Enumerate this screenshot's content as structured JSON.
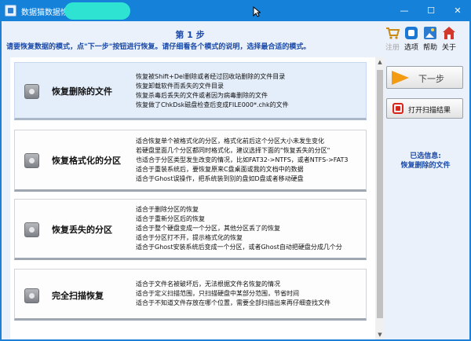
{
  "window": {
    "title": "数据猫数据恢复软件",
    "minimize": "—",
    "maximize": "☐",
    "close": "✕"
  },
  "header": {
    "step": "第 1 步",
    "desc": "请要恢复数据的模式，点\"下一步\"按钮进行恢复。请仔细看各个模式的说明，选择最合适的模式。"
  },
  "toolbar": {
    "items": [
      {
        "label": "注册",
        "icon": "cart-icon",
        "color": "#c98b16",
        "disabled": true
      },
      {
        "label": "选项",
        "icon": "options-icon",
        "color": "#1a78d4"
      },
      {
        "label": "帮助",
        "icon": "help-icon",
        "color": "#2b7bd1"
      },
      {
        "label": "关于",
        "icon": "home-icon",
        "color": "#d3392a"
      }
    ]
  },
  "modes": [
    {
      "title": "恢复删除的文件",
      "selected": true,
      "lines": [
        "恢复被Shift+Del删除或者经过回收站删除的文件目录",
        "恢复卸载软件而丢失的文件目录",
        "恢复杀毒后丢失的文件或者因为病毒删除的文件",
        "恢复做了ChkDsk磁盘检查后变成FILE000*.chk的文件"
      ]
    },
    {
      "title": "恢复格式化的分区",
      "selected": false,
      "lines": [
        "适合恢复单个被格式化的分区，格式化前后这个分区大小未发生变化",
        "若硬盘里面几个分区都同时格式化，建议选择下面的\"恢复丢失的分区\"",
        "也适合于分区类型发生改变的情况，比如FAT32->NTFS，或者NTFS->FAT3",
        "适合于重装系统后，要恢复原来C盘桌面或我的文档中的数据",
        "适合于Ghost误操作，把系统装到别的盘如D盘或者移动硬盘"
      ]
    },
    {
      "title": "恢复丢失的分区",
      "selected": false,
      "lines": [
        "适合于删除分区的恢复",
        "适合于重新分区后的恢复",
        "适合于整个硬盘变成一个分区，其他分区丢了的恢复",
        "适合于分区打不开，提示格式化的恢复",
        "适合于Ghost安装系统后变成一个分区，或者Ghost自动把硬盘分成几个分"
      ]
    },
    {
      "title": "完全扫描恢复",
      "selected": false,
      "lines": [
        "适合于文件名被破坏后，无法根据文件名恢复的情况",
        "适合于定义扫描范围，只扫描硬盘中某部分范围，节省时间",
        "适合于不知道文件存放在哪个位置，需要全部扫描出来再仔细查找文件"
      ]
    }
  ],
  "buttons": {
    "next": "下一步",
    "open_scan": "打开扫描结果"
  },
  "selected_info": {
    "label": "已选信息:",
    "value": "恢复删除的文件"
  },
  "scroll": {
    "up": "▲",
    "down": "▼"
  }
}
